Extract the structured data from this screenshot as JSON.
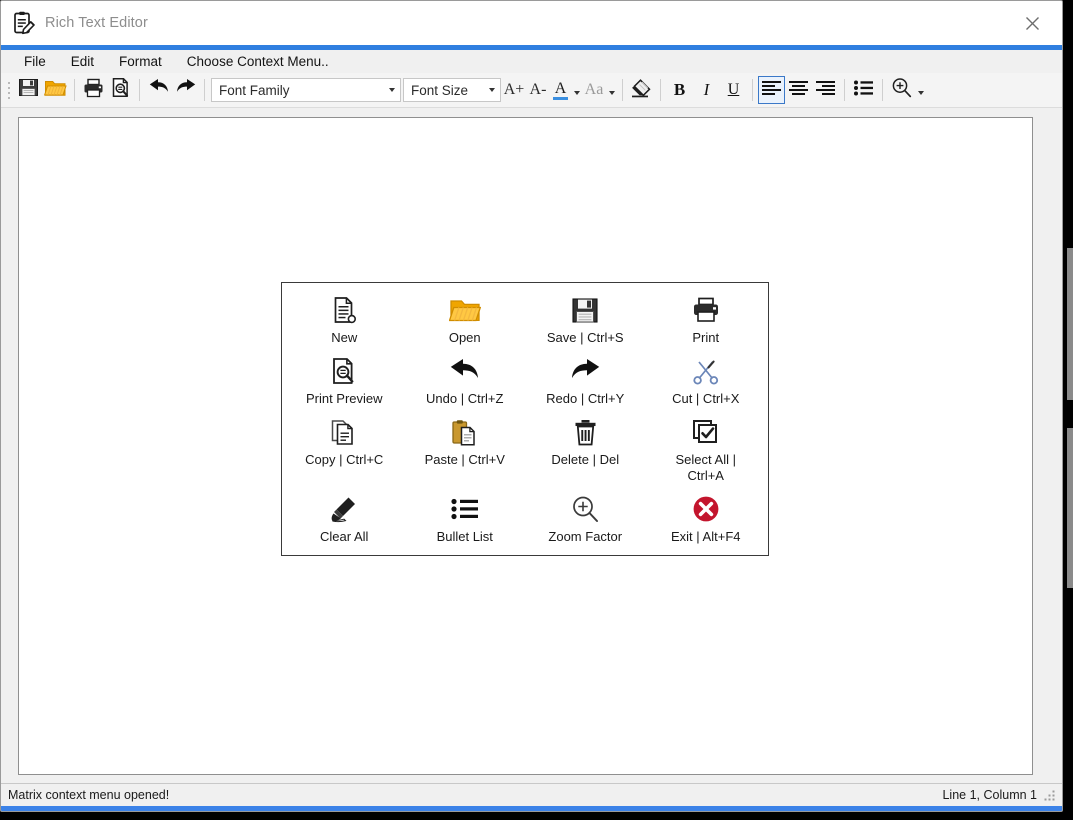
{
  "window": {
    "title": "Rich Text Editor",
    "app_icon": "clipboard-pen-icon",
    "close_icon": "close-icon",
    "accent_color": "#2f7fe0"
  },
  "menubar": {
    "items": [
      {
        "label": "File",
        "name": "menu-file"
      },
      {
        "label": "Edit",
        "name": "menu-edit"
      },
      {
        "label": "Format",
        "name": "menu-format"
      },
      {
        "label": "Choose Context Menu..",
        "name": "menu-choose-context-menu"
      }
    ]
  },
  "toolbar": {
    "save_icon": "save-floppy-icon",
    "open_icon": "open-folder-icon",
    "print_icon": "print-icon",
    "print_preview_icon": "print-preview-icon",
    "undo_icon": "undo-arrow-icon",
    "redo_icon": "redo-arrow-icon",
    "font_family": {
      "value": "Font Family",
      "placeholder": "Font Family"
    },
    "font_size": {
      "value": "Font Size",
      "placeholder": "Font Size"
    },
    "grow_font_label": "A+",
    "shrink_font_label": "A-",
    "font_color_label": "A",
    "font_color_swatch": "#3a8fe0",
    "text_case_label": "Aa",
    "clear_format_icon": "eraser-icon",
    "bold_label": "B",
    "italic_label": "I",
    "underline_label": "U",
    "align_left_icon": "align-left-icon",
    "align_center_icon": "align-center-icon",
    "align_right_icon": "align-right-icon",
    "bullet_list_icon": "bullet-list-icon",
    "zoom_icon": "zoom-in-magnifier-icon",
    "selected_button": "align-left"
  },
  "editor": {
    "content": ""
  },
  "context_menu": {
    "title": "Matrix context menu",
    "columns": 4,
    "items": [
      {
        "label": "New",
        "icon": "new-document-icon"
      },
      {
        "label": "Open",
        "icon": "open-folder-icon"
      },
      {
        "label": "Save | Ctrl+S",
        "icon": "save-floppy-icon"
      },
      {
        "label": "Print",
        "icon": "print-icon"
      },
      {
        "label": "Print Preview",
        "icon": "print-preview-icon"
      },
      {
        "label": "Undo | Ctrl+Z",
        "icon": "undo-arrow-icon"
      },
      {
        "label": "Redo | Ctrl+Y",
        "icon": "redo-arrow-icon"
      },
      {
        "label": "Cut | Ctrl+X",
        "icon": "scissors-icon"
      },
      {
        "label": "Copy | Ctrl+C",
        "icon": "copy-pages-icon"
      },
      {
        "label": "Paste | Ctrl+V",
        "icon": "paste-clipboard-icon"
      },
      {
        "label": "Delete | Del",
        "icon": "trash-bin-icon"
      },
      {
        "label": "Select All | Ctrl+A",
        "icon": "select-all-checkbox-icon"
      },
      {
        "label": "Clear All",
        "icon": "clear-brush-icon"
      },
      {
        "label": "Bullet List",
        "icon": "bullet-list-icon"
      },
      {
        "label": "Zoom Factor",
        "icon": "zoom-in-magnifier-icon"
      },
      {
        "label": "Exit | Alt+F4",
        "icon": "exit-close-circle-icon"
      }
    ]
  },
  "statusbar": {
    "message": "Matrix context menu opened!",
    "caret_position": "Line 1, Column 1",
    "resize_grip": "resize-grip-icon",
    "accent_color": "#3b82e8"
  }
}
